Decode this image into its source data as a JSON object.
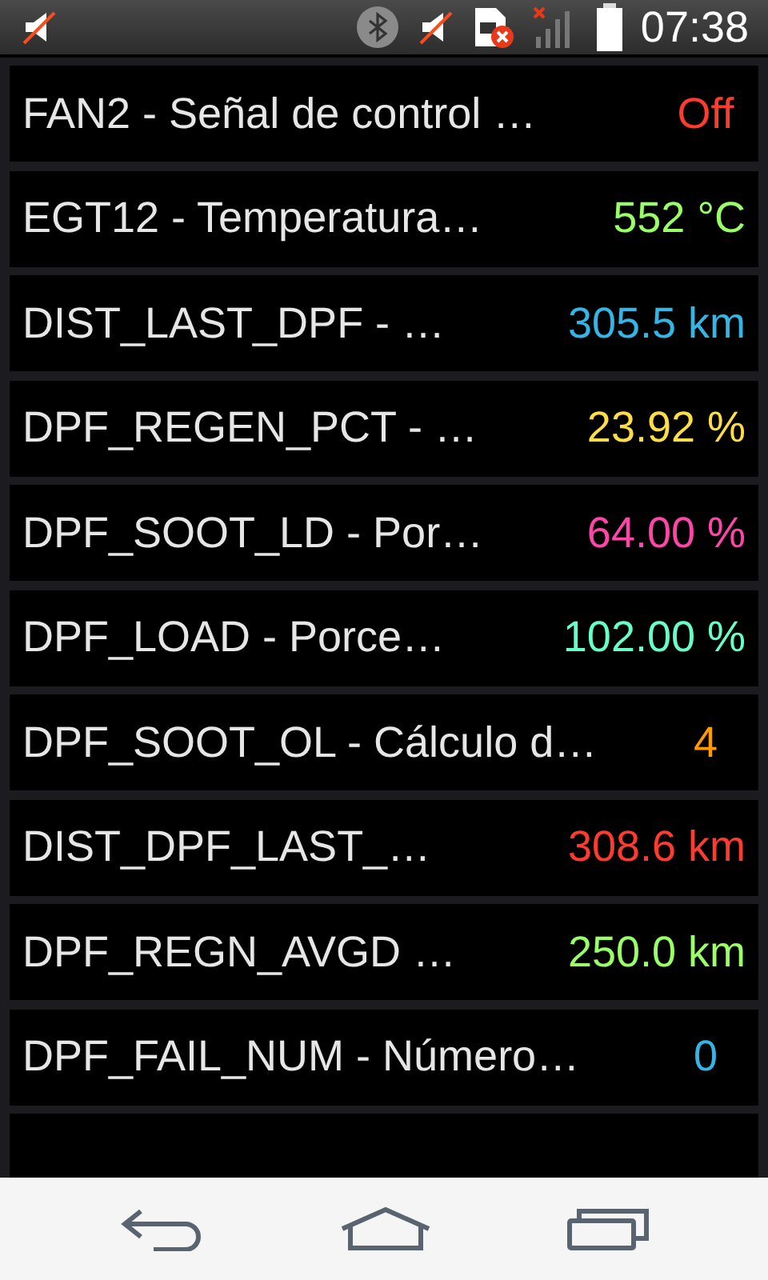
{
  "status_bar": {
    "time": "07:38"
  },
  "rows": [
    {
      "label": "FAN2 - Señal de control …",
      "value": "Off",
      "color": "#ff3b30"
    },
    {
      "label": "EGT12 - Temperatura…",
      "value": "552 °C",
      "color": "#99ff66"
    },
    {
      "label": "DIST_LAST_DPF - …",
      "value": "305.5 km",
      "color": "#33b5e5"
    },
    {
      "label": "DPF_REGEN_PCT - …",
      "value": "23.92 %",
      "color": "#ffdd44"
    },
    {
      "label": "DPF_SOOT_LD - Por…",
      "value": "64.00 %",
      "color": "#ff44aa"
    },
    {
      "label": "DPF_LOAD - Porce…",
      "value": "102.00 %",
      "color": "#66ffcc"
    },
    {
      "label": "DPF_SOOT_OL - Cálculo d…",
      "value": "4",
      "color": "#ff9900"
    },
    {
      "label": "DIST_DPF_LAST_…",
      "value": "308.6 km",
      "color": "#ff3b30"
    },
    {
      "label": "DPF_REGN_AVGD …",
      "value": "250.0 km",
      "color": "#99ff66"
    },
    {
      "label": "DPF_FAIL_NUM - Número…",
      "value": "0",
      "color": "#33b5e5"
    }
  ]
}
